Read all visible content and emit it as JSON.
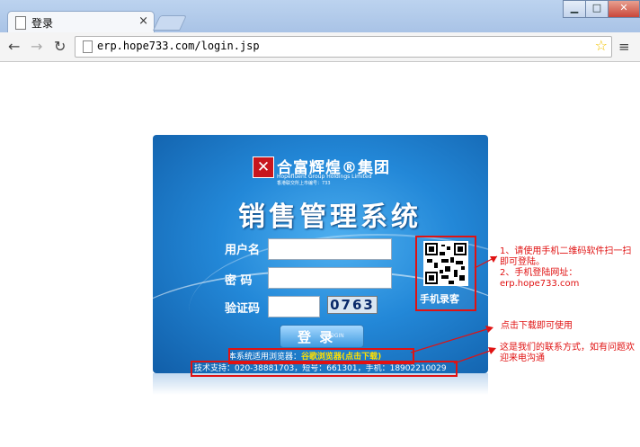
{
  "browser": {
    "tab_title": "登录",
    "tab_close": "×",
    "url": "erp.hope733.com/login.jsp",
    "window_buttons": {
      "minimize": "▁",
      "maximize": "□",
      "close": "✕"
    },
    "nav": {
      "back": "←",
      "forward": "→",
      "reload": "↻",
      "star": "☆",
      "menu": "≡"
    }
  },
  "login": {
    "company_name_cn": "合富辉煌®集团",
    "company_name_en": "Hopefluent Group Holdings Limited",
    "company_sub": "香港联交所上市编号：733",
    "system_title": "销售管理系统",
    "labels": {
      "username": "用户名",
      "password": "密 码",
      "captcha": "验证码"
    },
    "captcha_value": "0763",
    "login_button": {
      "cn": "登 录",
      "en": "LOGIN"
    },
    "browser_note_prefix": "本系统适用浏览器：",
    "browser_note_link": "谷歌浏览器(点击下载)",
    "support_text": "技术支持：020-38881703，短号：661301，手机：18902210029",
    "qr_label": "手机录客"
  },
  "annotations": {
    "qr_note": [
      "1、请使用手机二维码软件扫一扫即可登陆。",
      "2、手机登陆网址：",
      "erp.hope733.com"
    ],
    "browser_note": "点击下载即可使用",
    "contact_note": "这是我们的联系方式，如有问题欢迎来电沟通"
  },
  "colors": {
    "annotation_red": "#e01212",
    "panel_blue": "#2388d8",
    "link_yellow": "#ffe000"
  }
}
